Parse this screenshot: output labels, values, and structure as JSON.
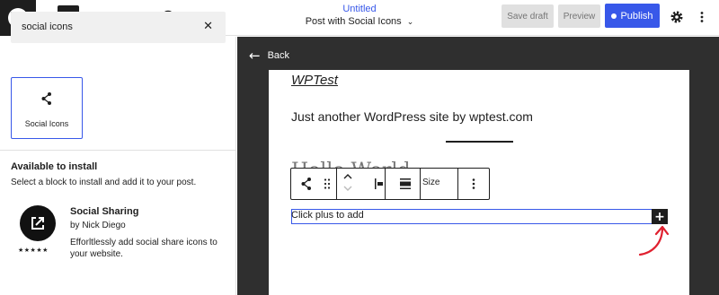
{
  "header": {
    "doc_title": "Untitled",
    "doc_subtitle": "Post with Social Icons",
    "save_draft_label": "Save draft",
    "preview_label": "Preview",
    "publish_label": "Publish"
  },
  "inserter": {
    "search_value": "social icons",
    "block_result": {
      "label": "Social Icons",
      "icon": "share-icon"
    },
    "available_heading": "Available to install",
    "available_description": "Select a block to install and add it to your post.",
    "plugin": {
      "name": "Social Sharing",
      "author": "by Nick Diego",
      "description": "Efforltlessly add social share icons to your website.",
      "rating_stars": "★★★★★"
    }
  },
  "canvas": {
    "back_label": "Back",
    "site_title": "WPTest",
    "tagline": "Just another WordPress site by wptest.com",
    "ghost_text": "Hello World",
    "block_toolbar": {
      "size_label": "Size"
    },
    "block_placeholder": "Click plus to add"
  },
  "colors": {
    "accent": "#3858e9",
    "dark": "#1e1e1e",
    "canvas_bg": "#2f2f2f",
    "annotation": "#e0202f"
  }
}
